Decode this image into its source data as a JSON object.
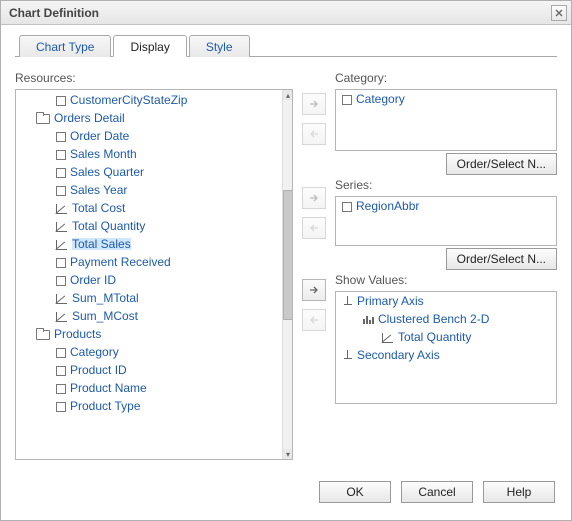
{
  "title": "Chart Definition",
  "tabs": [
    "Chart Type",
    "Display",
    "Style"
  ],
  "active_tab": 1,
  "resources_label": "Resources:",
  "resources_tree": [
    {
      "label": "CustomerCityStateZip",
      "kind": "field",
      "depth": 1
    },
    {
      "label": "Orders Detail",
      "kind": "folder",
      "depth": 0
    },
    {
      "label": "Order Date",
      "kind": "field",
      "depth": 1
    },
    {
      "label": "Sales Month",
      "kind": "field",
      "depth": 1
    },
    {
      "label": "Sales Quarter",
      "kind": "field",
      "depth": 1
    },
    {
      "label": "Sales Year",
      "kind": "field",
      "depth": 1
    },
    {
      "label": "Total Cost",
      "kind": "measure",
      "depth": 1
    },
    {
      "label": "Total Quantity",
      "kind": "measure",
      "depth": 1
    },
    {
      "label": "Total Sales",
      "kind": "measure",
      "depth": 1,
      "selected": true
    },
    {
      "label": "Payment Received",
      "kind": "field",
      "depth": 1
    },
    {
      "label": "Order ID",
      "kind": "field",
      "depth": 1
    },
    {
      "label": "Sum_MTotal",
      "kind": "measure",
      "depth": 1
    },
    {
      "label": "Sum_MCost",
      "kind": "measure",
      "depth": 1
    },
    {
      "label": "Products",
      "kind": "folder",
      "depth": 0
    },
    {
      "label": "Category",
      "kind": "field",
      "depth": 1
    },
    {
      "label": "Product ID",
      "kind": "field",
      "depth": 1
    },
    {
      "label": "Product Name",
      "kind": "field",
      "depth": 1
    },
    {
      "label": "Product Type",
      "kind": "field",
      "depth": 1
    }
  ],
  "category": {
    "label": "Category:",
    "items": [
      {
        "label": "Category",
        "kind": "field"
      }
    ],
    "button": "Order/Select N..."
  },
  "series": {
    "label": "Series:",
    "items": [
      {
        "label": "RegionAbbr",
        "kind": "field"
      }
    ],
    "button": "Order/Select N..."
  },
  "show_values": {
    "label": "Show Values:",
    "rows": [
      {
        "label": "Primary Axis",
        "kind": "axis",
        "depth": 0
      },
      {
        "label": "Clustered Bench 2-D",
        "kind": "chartset",
        "depth": 1
      },
      {
        "label": "Total Quantity",
        "kind": "measure",
        "depth": 2
      },
      {
        "label": "Secondary Axis",
        "kind": "axis",
        "depth": 0
      }
    ]
  },
  "footer": {
    "ok": "OK",
    "cancel": "Cancel",
    "help": "Help"
  }
}
